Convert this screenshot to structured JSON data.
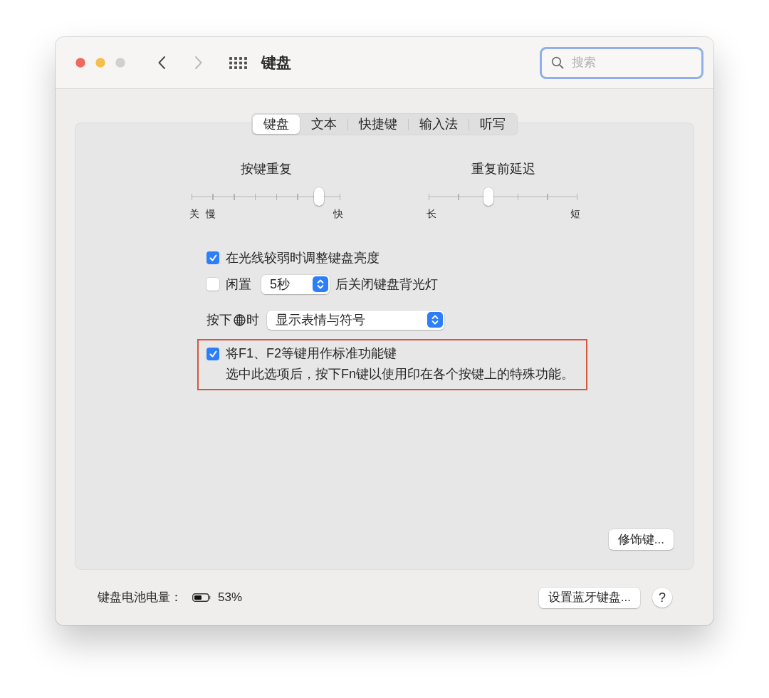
{
  "window": {
    "title": "键盘",
    "traffic_lights": [
      {
        "kind": "close",
        "disabled": false
      },
      {
        "kind": "minimize",
        "disabled": false
      },
      {
        "kind": "zoom",
        "disabled": true
      }
    ],
    "back": {
      "disabled": false
    },
    "forward": {
      "disabled": true
    }
  },
  "search": {
    "placeholder": "搜索",
    "focused": true
  },
  "tabs": [
    {
      "label": "键盘",
      "selected": true
    },
    {
      "label": "文本",
      "selected": false
    },
    {
      "label": "快捷键",
      "selected": false
    },
    {
      "label": "输入法",
      "selected": false
    },
    {
      "label": "听写",
      "selected": false
    }
  ],
  "sliders": [
    {
      "kind": "rate",
      "title": "按键重复",
      "level": 0.86,
      "min_labels": [
        "关",
        "慢"
      ],
      "max_label": "快"
    },
    {
      "kind": "delay",
      "title": "重复前延迟",
      "level": 0.4,
      "min_labels": [
        "长"
      ],
      "max_label": "短"
    }
  ],
  "options": [
    {
      "kind": "checkbox",
      "label": "在光线较弱时调整键盘亮度",
      "checked": true,
      "highlighted": false
    },
    {
      "kind": "checkselect",
      "label": "闲置",
      "checked": false,
      "popup": "5秒",
      "suffix": "后关闭键盘背光灯",
      "highlighted": false
    },
    {
      "kind": "select",
      "label": "按下",
      "suffix": "时",
      "popup": "显示表情与符号",
      "highlighted": false
    },
    {
      "kind": "checkbox",
      "label": "将F1、F2等键用作标准功能键",
      "description": "选中此选项后，按下Fn键以使用印在各个按键上的特殊功能。",
      "checked": true,
      "highlighted": true
    }
  ],
  "modifier_button": "修饰键...",
  "footer": {
    "battery_label": "键盘电池电量：",
    "battery_reading": "53%",
    "bluetooth_button": "设置蓝牙键盘...",
    "help_button": "?"
  }
}
